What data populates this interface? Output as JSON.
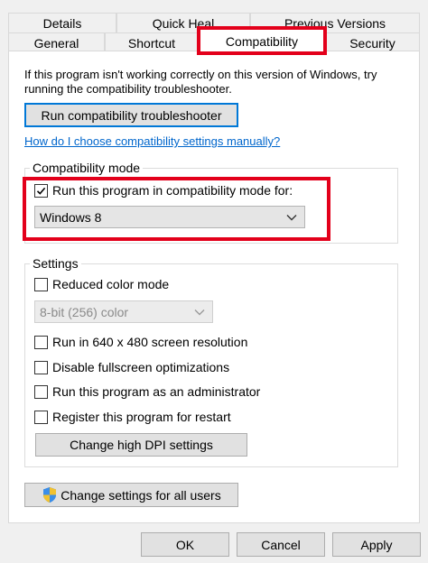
{
  "tabs": {
    "row1": [
      "Details",
      "Quick Heal",
      "Previous Versions"
    ],
    "row2": [
      "General",
      "Shortcut",
      "Compatibility",
      "Security"
    ]
  },
  "intro": {
    "line1": "If this program isn't working correctly on this version of Windows, try",
    "line2": "running the compatibility troubleshooter."
  },
  "troubleshooter_button": "Run compatibility troubleshooter",
  "help_link": "How do I choose compatibility settings manually?",
  "compat_mode": {
    "legend": "Compatibility mode",
    "checkbox_label": "Run this program in compatibility mode for:",
    "checked": true,
    "selected_os": "Windows 8"
  },
  "settings": {
    "legend": "Settings",
    "reduced_color": "Reduced color mode",
    "color_select": "8-bit (256) color",
    "res_640": "Run in 640 x 480 screen resolution",
    "disable_fullscreen": "Disable fullscreen optimizations",
    "run_admin": "Run this program as an administrator",
    "register_restart": "Register this program for restart",
    "dpi_button": "Change high DPI settings"
  },
  "all_users_button": "Change settings for all users",
  "footer": {
    "ok": "OK",
    "cancel": "Cancel",
    "apply": "Apply"
  },
  "colors": {
    "highlight": "#e3001b",
    "link": "#0066cc",
    "focus": "#0078d7"
  },
  "icons": {
    "checkmark": "check-icon",
    "shield": "uac-shield-icon",
    "dropdown": "chevron-down-icon"
  }
}
